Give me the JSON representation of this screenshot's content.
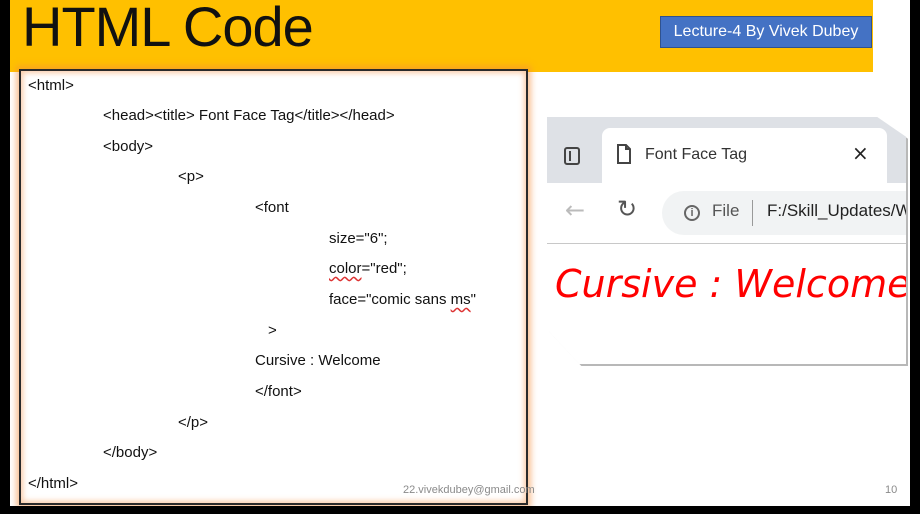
{
  "slide": {
    "title": "HTML Code",
    "badge": "Lecture-4 By Vivek Dubey",
    "email": "22.vivekdubey@gmail.com",
    "page_number": "10"
  },
  "code": {
    "lines": [
      "<html>",
      "<head><title> Font Face Tag</title></head>",
      "<body>",
      "<p>",
      "<font",
      "size=\"6\";",
      "color=\"red\";",
      "face=\"comic sans ms\"",
      ">",
      "Cursive : Welcome",
      "</font>",
      "</p>",
      "</body>",
      "</html>"
    ]
  },
  "browser": {
    "tab_title": "Font Face Tag",
    "close_glyph": "×",
    "info_glyph": "i",
    "file_label": "File",
    "url": "F:/Skill_Updates/W",
    "page_text": "Cursive : Welcome"
  },
  "colors": {
    "title_bar": "#ffc000",
    "badge": "#4472c4",
    "rendered_text": "#ff0000"
  },
  "icons": [
    "window-menu-icon",
    "document-icon",
    "close-icon",
    "back-arrow-icon",
    "reload-icon",
    "info-icon"
  ]
}
